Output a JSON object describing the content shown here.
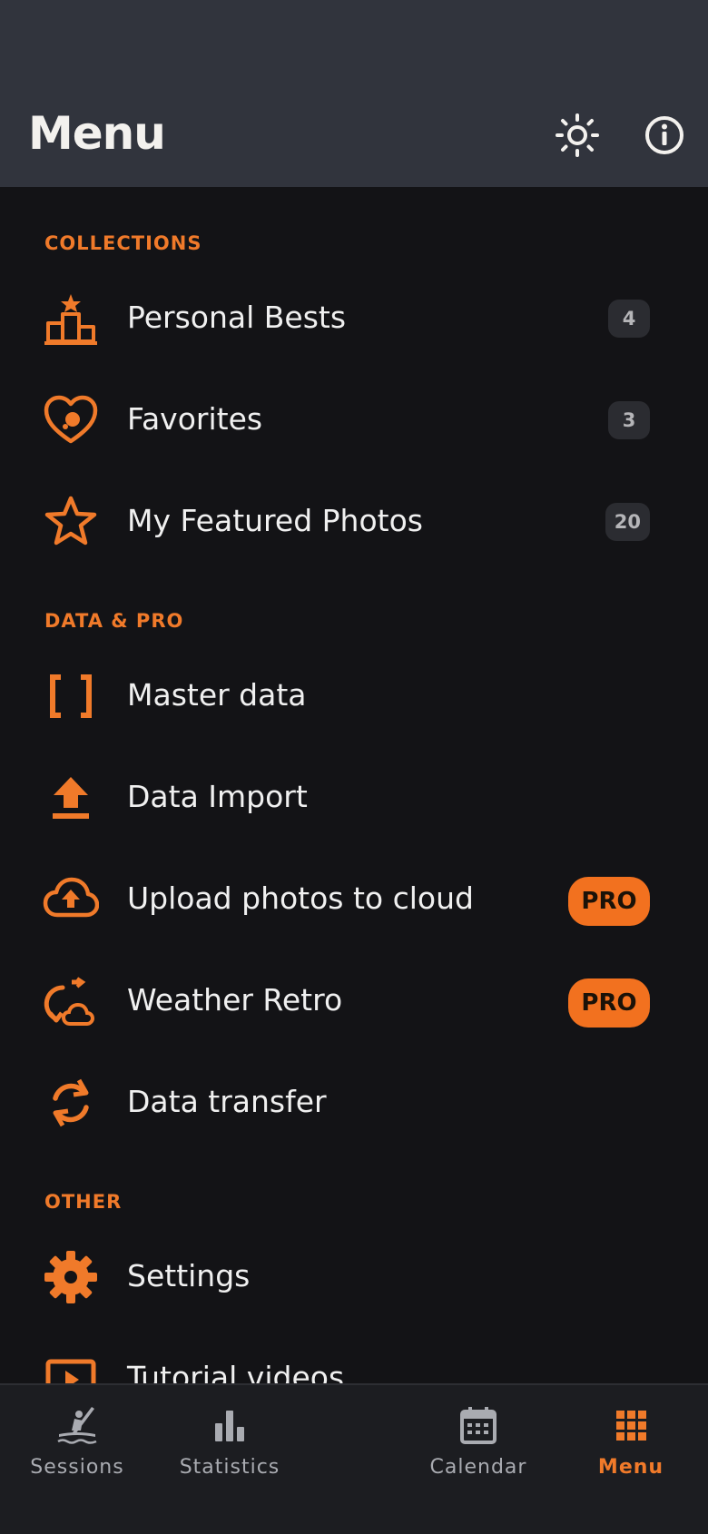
{
  "header": {
    "title": "Menu"
  },
  "sections": {
    "collections": "COLLECTIONS",
    "data_pro": "DATA & PRO",
    "other": "OTHER"
  },
  "items": {
    "personal_bests": {
      "label": "Personal Bests",
      "count": "4",
      "icon": "podium-icon"
    },
    "favorites": {
      "label": "Favorites",
      "count": "3",
      "icon": "heart-icon"
    },
    "featured_photos": {
      "label": "My Featured Photos",
      "count": "20",
      "icon": "star-icon"
    },
    "master_data": {
      "label": "Master data",
      "icon": "brackets-icon"
    },
    "data_import": {
      "label": "Data Import",
      "icon": "upload-icon"
    },
    "upload_cloud": {
      "label": "Upload photos to cloud",
      "badge": "PRO",
      "icon": "cloud-upload-icon"
    },
    "weather_retro": {
      "label": "Weather Retro",
      "badge": "PRO",
      "icon": "weather-retro-icon"
    },
    "data_transfer": {
      "label": "Data transfer",
      "icon": "sync-icon"
    },
    "settings": {
      "label": "Settings",
      "icon": "gear-icon"
    },
    "tutorial_videos": {
      "label": "Tutorial videos",
      "icon": "video-icon"
    }
  },
  "tabs": {
    "sessions": "Sessions",
    "statistics": "Statistics",
    "calendar": "Calendar",
    "menu": "Menu"
  },
  "colors": {
    "accent": "#f07a2a",
    "background": "#131316",
    "header": "#31343d"
  }
}
